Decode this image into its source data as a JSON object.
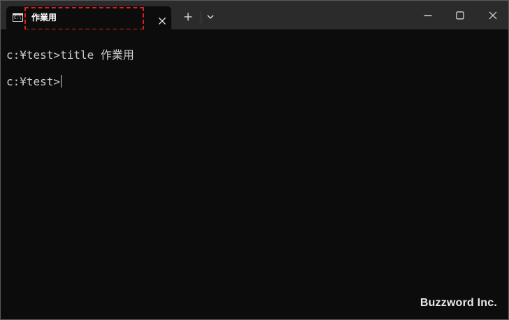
{
  "tab": {
    "title": "作業用",
    "icon": "terminal-icon",
    "icon_text": "C:\\_"
  },
  "titlebar": {
    "new_tab_icon": "plus-icon",
    "dropdown_icon": "chevron-down-icon",
    "minimize_icon": "minimize-icon",
    "maximize_icon": "maximize-icon",
    "close_icon": "close-icon"
  },
  "terminal": {
    "lines": [
      "c:¥test>title 作業用",
      "c:¥test>"
    ]
  },
  "watermark": "Buzzword Inc.",
  "colors": {
    "titlebar_bg": "#2b2b2b",
    "terminal_bg": "#0c0c0c",
    "text": "#cccccc",
    "highlight": "#e01e1e"
  }
}
